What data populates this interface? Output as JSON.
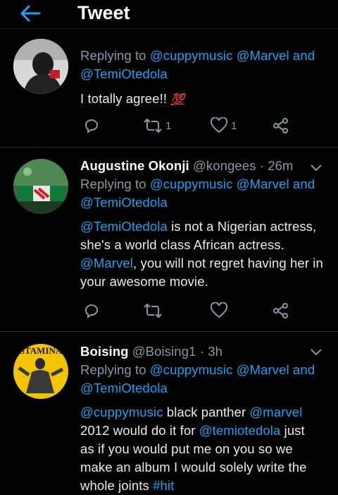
{
  "header": {
    "title": "Tweet"
  },
  "tweets": [
    {
      "reply_prefix": "Replying to",
      "reply_handles": "@cuppymusic @Marvel and",
      "reply_handles_2": "@TemiOtedola",
      "text": "I totally agree!!",
      "emoji": "💯",
      "retweets": "1",
      "likes": "1"
    },
    {
      "name": "Augustine Okonji",
      "handle": "@kongees",
      "time": "· 26m",
      "reply_prefix": "Replying to",
      "reply_handles": "@cuppymusic @Marvel and",
      "reply_handles_2": "@TemiOtedola",
      "lines": [
        {
          "pre": "",
          "mention": "@TemiOtedola",
          "post": " is not a Nigerian actress,"
        },
        {
          "pre": "she's a world class African actress.",
          "mention": "",
          "post": ""
        },
        {
          "pre": "",
          "mention": "@Marvel",
          "post": ", you will not regret having her in"
        },
        {
          "pre": "your awesome movie.",
          "mention": "",
          "post": ""
        }
      ]
    },
    {
      "name": "Boising",
      "handle": "@Boising1",
      "time": "· 3h",
      "avatar_text": "STAMINA",
      "reply_prefix": "Replying to",
      "reply_handles": "@cuppymusic @Marvel and",
      "reply_handles_2": "@TemiOtedola",
      "lines": [
        {
          "pre": "",
          "mention": "@cuppymusic",
          "post": " black panther "
        },
        {
          "pre": "2012 would do it for ",
          "mention": "@temiotedola",
          "post": " just"
        },
        {
          "pre": "as if you would put me on you so we",
          "mention": "",
          "post": ""
        },
        {
          "pre": "make an album I would solely write the",
          "mention": "",
          "post": ""
        },
        {
          "pre": "whole joints ",
          "mention": "#hit",
          "post": ""
        }
      ],
      "line0_mention2": "@marvel"
    }
  ],
  "colors": {
    "accent": "#1da1f2",
    "muted": "#8899a6",
    "background": "#000000"
  },
  "icons": [
    "back-arrow-icon",
    "reply-icon",
    "retweet-icon",
    "like-icon",
    "share-icon",
    "chevron-down-icon"
  ]
}
